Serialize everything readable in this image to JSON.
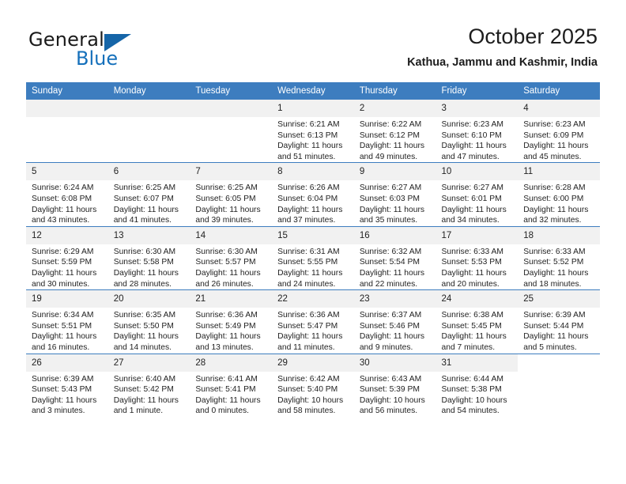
{
  "brand": {
    "name_top": "General",
    "name_bottom": "Blue",
    "accent_color": "#1570bb",
    "header_color": "#3d7dbf"
  },
  "header": {
    "title": "October 2025",
    "subtitle": "Kathua, Jammu and Kashmir, India"
  },
  "weekdays": [
    "Sunday",
    "Monday",
    "Tuesday",
    "Wednesday",
    "Thursday",
    "Friday",
    "Saturday"
  ],
  "weeks": [
    [
      {
        "day": "",
        "lines": []
      },
      {
        "day": "",
        "lines": []
      },
      {
        "day": "",
        "lines": []
      },
      {
        "day": "1",
        "lines": [
          "Sunrise: 6:21 AM",
          "Sunset: 6:13 PM",
          "Daylight: 11 hours",
          "and 51 minutes."
        ]
      },
      {
        "day": "2",
        "lines": [
          "Sunrise: 6:22 AM",
          "Sunset: 6:12 PM",
          "Daylight: 11 hours",
          "and 49 minutes."
        ]
      },
      {
        "day": "3",
        "lines": [
          "Sunrise: 6:23 AM",
          "Sunset: 6:10 PM",
          "Daylight: 11 hours",
          "and 47 minutes."
        ]
      },
      {
        "day": "4",
        "lines": [
          "Sunrise: 6:23 AM",
          "Sunset: 6:09 PM",
          "Daylight: 11 hours",
          "and 45 minutes."
        ]
      }
    ],
    [
      {
        "day": "5",
        "lines": [
          "Sunrise: 6:24 AM",
          "Sunset: 6:08 PM",
          "Daylight: 11 hours",
          "and 43 minutes."
        ]
      },
      {
        "day": "6",
        "lines": [
          "Sunrise: 6:25 AM",
          "Sunset: 6:07 PM",
          "Daylight: 11 hours",
          "and 41 minutes."
        ]
      },
      {
        "day": "7",
        "lines": [
          "Sunrise: 6:25 AM",
          "Sunset: 6:05 PM",
          "Daylight: 11 hours",
          "and 39 minutes."
        ]
      },
      {
        "day": "8",
        "lines": [
          "Sunrise: 6:26 AM",
          "Sunset: 6:04 PM",
          "Daylight: 11 hours",
          "and 37 minutes."
        ]
      },
      {
        "day": "9",
        "lines": [
          "Sunrise: 6:27 AM",
          "Sunset: 6:03 PM",
          "Daylight: 11 hours",
          "and 35 minutes."
        ]
      },
      {
        "day": "10",
        "lines": [
          "Sunrise: 6:27 AM",
          "Sunset: 6:01 PM",
          "Daylight: 11 hours",
          "and 34 minutes."
        ]
      },
      {
        "day": "11",
        "lines": [
          "Sunrise: 6:28 AM",
          "Sunset: 6:00 PM",
          "Daylight: 11 hours",
          "and 32 minutes."
        ]
      }
    ],
    [
      {
        "day": "12",
        "lines": [
          "Sunrise: 6:29 AM",
          "Sunset: 5:59 PM",
          "Daylight: 11 hours",
          "and 30 minutes."
        ]
      },
      {
        "day": "13",
        "lines": [
          "Sunrise: 6:30 AM",
          "Sunset: 5:58 PM",
          "Daylight: 11 hours",
          "and 28 minutes."
        ]
      },
      {
        "day": "14",
        "lines": [
          "Sunrise: 6:30 AM",
          "Sunset: 5:57 PM",
          "Daylight: 11 hours",
          "and 26 minutes."
        ]
      },
      {
        "day": "15",
        "lines": [
          "Sunrise: 6:31 AM",
          "Sunset: 5:55 PM",
          "Daylight: 11 hours",
          "and 24 minutes."
        ]
      },
      {
        "day": "16",
        "lines": [
          "Sunrise: 6:32 AM",
          "Sunset: 5:54 PM",
          "Daylight: 11 hours",
          "and 22 minutes."
        ]
      },
      {
        "day": "17",
        "lines": [
          "Sunrise: 6:33 AM",
          "Sunset: 5:53 PM",
          "Daylight: 11 hours",
          "and 20 minutes."
        ]
      },
      {
        "day": "18",
        "lines": [
          "Sunrise: 6:33 AM",
          "Sunset: 5:52 PM",
          "Daylight: 11 hours",
          "and 18 minutes."
        ]
      }
    ],
    [
      {
        "day": "19",
        "lines": [
          "Sunrise: 6:34 AM",
          "Sunset: 5:51 PM",
          "Daylight: 11 hours",
          "and 16 minutes."
        ]
      },
      {
        "day": "20",
        "lines": [
          "Sunrise: 6:35 AM",
          "Sunset: 5:50 PM",
          "Daylight: 11 hours",
          "and 14 minutes."
        ]
      },
      {
        "day": "21",
        "lines": [
          "Sunrise: 6:36 AM",
          "Sunset: 5:49 PM",
          "Daylight: 11 hours",
          "and 13 minutes."
        ]
      },
      {
        "day": "22",
        "lines": [
          "Sunrise: 6:36 AM",
          "Sunset: 5:47 PM",
          "Daylight: 11 hours",
          "and 11 minutes."
        ]
      },
      {
        "day": "23",
        "lines": [
          "Sunrise: 6:37 AM",
          "Sunset: 5:46 PM",
          "Daylight: 11 hours",
          "and 9 minutes."
        ]
      },
      {
        "day": "24",
        "lines": [
          "Sunrise: 6:38 AM",
          "Sunset: 5:45 PM",
          "Daylight: 11 hours",
          "and 7 minutes."
        ]
      },
      {
        "day": "25",
        "lines": [
          "Sunrise: 6:39 AM",
          "Sunset: 5:44 PM",
          "Daylight: 11 hours",
          "and 5 minutes."
        ]
      }
    ],
    [
      {
        "day": "26",
        "lines": [
          "Sunrise: 6:39 AM",
          "Sunset: 5:43 PM",
          "Daylight: 11 hours",
          "and 3 minutes."
        ]
      },
      {
        "day": "27",
        "lines": [
          "Sunrise: 6:40 AM",
          "Sunset: 5:42 PM",
          "Daylight: 11 hours",
          "and 1 minute."
        ]
      },
      {
        "day": "28",
        "lines": [
          "Sunrise: 6:41 AM",
          "Sunset: 5:41 PM",
          "Daylight: 11 hours",
          "and 0 minutes."
        ]
      },
      {
        "day": "29",
        "lines": [
          "Sunrise: 6:42 AM",
          "Sunset: 5:40 PM",
          "Daylight: 10 hours",
          "and 58 minutes."
        ]
      },
      {
        "day": "30",
        "lines": [
          "Sunrise: 6:43 AM",
          "Sunset: 5:39 PM",
          "Daylight: 10 hours",
          "and 56 minutes."
        ]
      },
      {
        "day": "31",
        "lines": [
          "Sunrise: 6:44 AM",
          "Sunset: 5:38 PM",
          "Daylight: 10 hours",
          "and 54 minutes."
        ]
      },
      {
        "day": "",
        "lines": []
      }
    ]
  ]
}
